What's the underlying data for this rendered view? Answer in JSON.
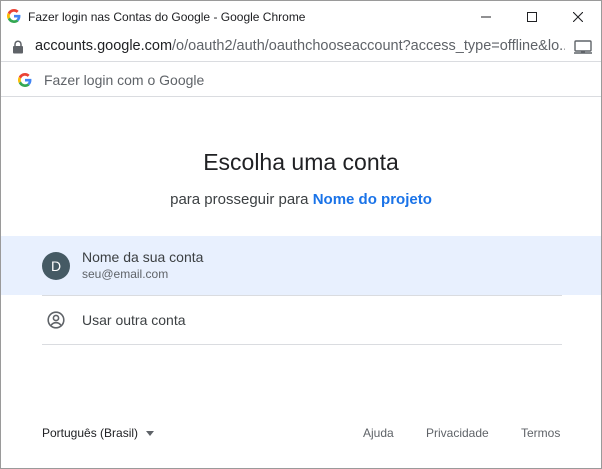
{
  "window": {
    "title": "Fazer login nas Contas do Google - Google Chrome",
    "controls": [
      "minimize",
      "maximize",
      "close"
    ]
  },
  "address_bar": {
    "url_host": "accounts.google.com",
    "url_path": "/o/oauth2/auth/oauthchooseaccount?access_type=offline&lo..."
  },
  "header": {
    "text": "Fazer login com o Google"
  },
  "main": {
    "heading": "Escolha uma conta",
    "sub_prefix": "para prosseguir para",
    "project_name": "Nome do projeto"
  },
  "accounts": [
    {
      "initial": "D",
      "name": "Nome da sua conta",
      "email": "seu@email.com"
    }
  ],
  "other_account": {
    "label": "Usar outra conta"
  },
  "footer": {
    "language": "Português (Brasil)",
    "help": "Ajuda",
    "privacy": "Privacidade",
    "terms": "Termos"
  },
  "colors": {
    "accent": "#1a73e8",
    "selected_row": "#e8f0fe",
    "avatar": "#455a64",
    "divider": "#dadce0"
  },
  "icons": [
    "google-g-icon",
    "minimize-icon",
    "maximize-icon",
    "close-icon",
    "lock-icon",
    "cast-icon",
    "account-circle-icon",
    "dropdown-caret-icon"
  ]
}
